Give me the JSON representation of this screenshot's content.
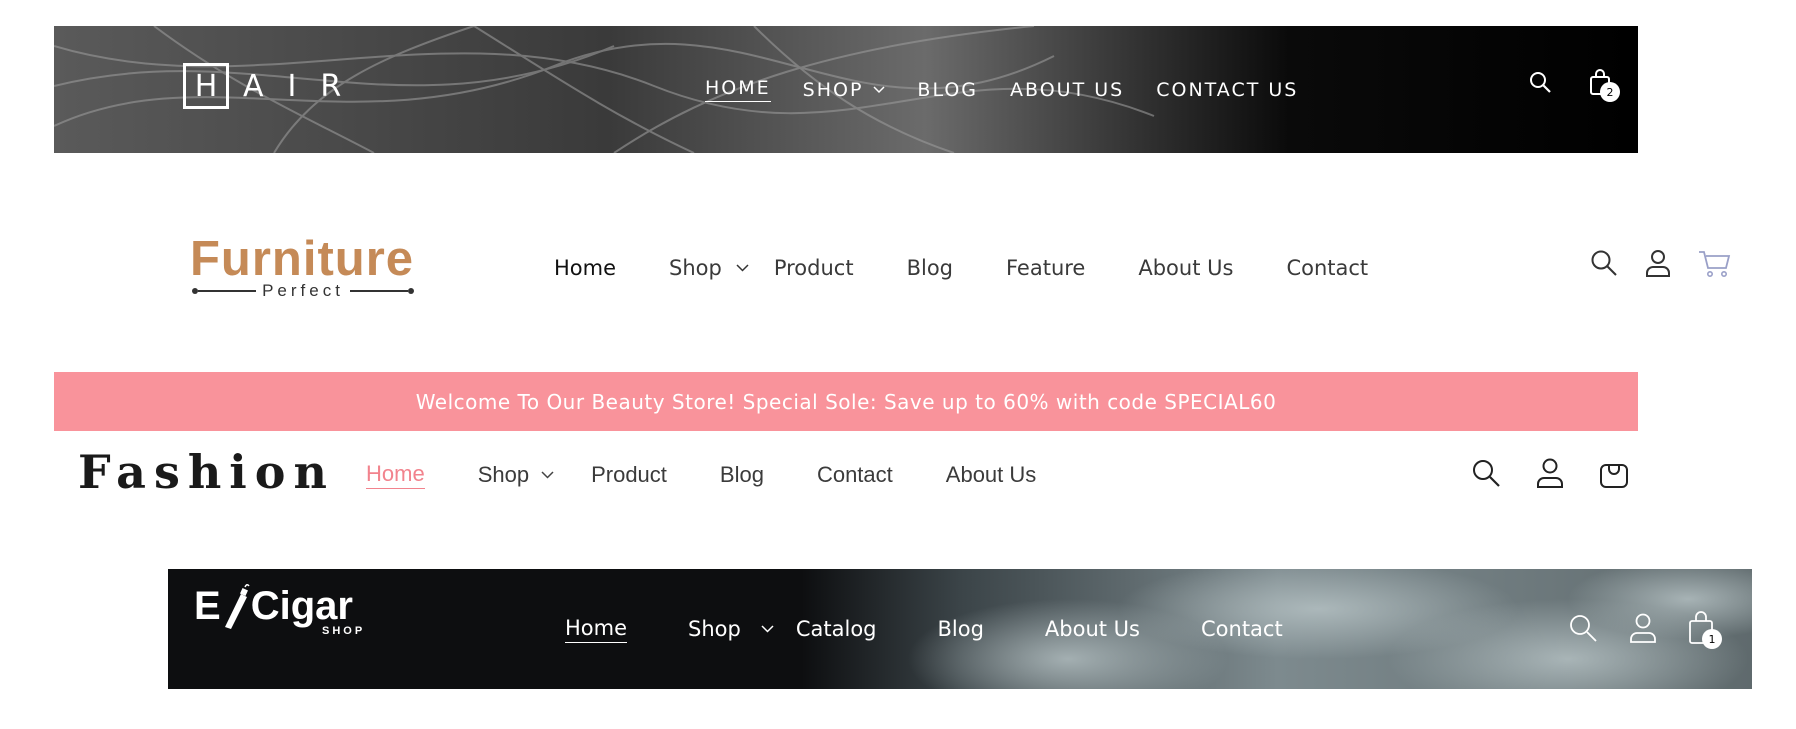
{
  "hair": {
    "logo_box_letter": "H",
    "logo_rest": "AIR",
    "nav": [
      {
        "label": "HOME"
      },
      {
        "label": "SHOP"
      },
      {
        "label": "BLOG"
      },
      {
        "label": "ABOUT US"
      },
      {
        "label": "CONTACT US"
      }
    ],
    "cart_count": "2",
    "icons": [
      "search-icon",
      "shopping-bag-icon"
    ]
  },
  "furniture": {
    "logo_main": "Furniture",
    "logo_sub": "Perfect",
    "brand_color": "#c58a57",
    "nav": [
      {
        "label": "Home"
      },
      {
        "label": "Shop"
      },
      {
        "label": "Product"
      },
      {
        "label": "Blog"
      },
      {
        "label": "Feature"
      },
      {
        "label": "About Us"
      },
      {
        "label": "Contact"
      }
    ],
    "icons": [
      "search-icon",
      "user-icon",
      "cart-icon"
    ]
  },
  "fashion": {
    "banner_text": "Welcome To Our Beauty Store! Special Sole: Save up to 60% with code SPECIAL60",
    "banner_color": "#f9939b",
    "logo": "Fashion",
    "accent": "#f2838d",
    "nav": [
      {
        "label": "Home"
      },
      {
        "label": "Shop"
      },
      {
        "label": "Product"
      },
      {
        "label": "Blog"
      },
      {
        "label": "Contact"
      },
      {
        "label": "About Us"
      }
    ],
    "icons": [
      "search-icon",
      "user-icon",
      "bag-icon"
    ]
  },
  "ecigar": {
    "logo_e": "E",
    "logo_main": "Cigar",
    "logo_sub": "SHOP",
    "nav": [
      {
        "label": "Home"
      },
      {
        "label": "Shop"
      },
      {
        "label": "Catalog"
      },
      {
        "label": "Blog"
      },
      {
        "label": "About Us"
      },
      {
        "label": "Contact"
      }
    ],
    "cart_count": "1",
    "icons": [
      "search-icon",
      "user-icon",
      "shopping-bag-icon"
    ]
  }
}
